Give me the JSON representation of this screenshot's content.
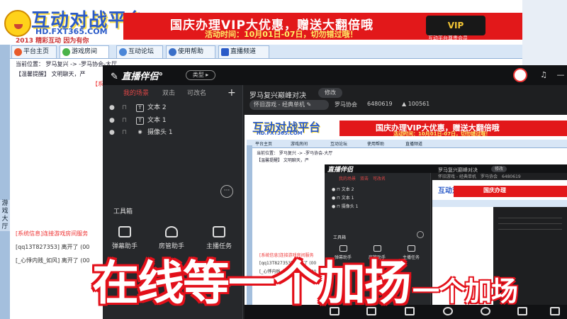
{
  "site": {
    "logo_title": "互动对战平台",
    "logo_url": "HD.FXT365.COM",
    "logo_slogan": "2013 精彩互动 因为有你",
    "banner_title": "国庆办理VIP大优惠，赠送大翻倍哦",
    "banner_sub": "活动时间：10月01日-07日，切勿错过哦！",
    "vip_badge": "VIP",
    "vip_caption": "互动平台尊贵会员",
    "nav_tabs": [
      "平台主页",
      "游戏房间",
      "互动论坛",
      "使用帮助",
      "直播频道"
    ],
    "breadcrumb": "当前位置： 罗马复兴 -> -罗马协会-大厅",
    "notice": "【温馨提醒】 文明聊天，严",
    "system_red": "【系统",
    "game_room_label": "游戏大厅",
    "chat": [
      {
        "text": "[系统信息]连接游戏房间服务",
        "color": "#e33"
      },
      {
        "text": "[qq13T827353]  离开了 (00",
        "color": "#333"
      },
      {
        "text": "[_心悸内贱_如风]  离开了 (00",
        "color": "#333"
      }
    ]
  },
  "app": {
    "logo": "直播伴侣",
    "type_button": "类型",
    "scene_tabs": [
      "我的场景",
      "双击",
      "可改名"
    ],
    "add": "+",
    "sources": [
      {
        "label": "文本 2",
        "type": "T"
      },
      {
        "label": "文本 1",
        "type": "T"
      },
      {
        "label": "摄像头 1",
        "type": "◉"
      }
    ],
    "toolbox": "工具箱",
    "toolbox_more": "···",
    "tools": [
      "弹幕助手",
      "房管助手",
      "主播任务"
    ],
    "stream_title": "罗马复兴巅峰对决",
    "edit": "修改",
    "category": "怀旧游戏 - 经典单机 ✎",
    "room_name": "罗马协会",
    "room_id": "6480619",
    "fans": "▲ 100561"
  },
  "nested": {
    "logo": "互动对战平台",
    "url": "HD.FXT365.COM",
    "banner_title": "国庆办理VIP大优惠，赠送大翻倍哦",
    "banner_sub": "活动时间：10月01日-07日，切勿错过哦！",
    "nav": [
      "平台主页",
      "游戏房间",
      "互动论坛",
      "使用帮助",
      "直播频道"
    ],
    "breadcrumb": "当前位置： 罗马复兴 -> -罗马协会-大厅",
    "notice": "【温馨提醒】 文明聊天，严",
    "system_red": "[系统信息]连接游戏房间服务",
    "chat": "[qq13T827353]  离开了 (00\n[_心悸内贱_如风]  离开了 (00",
    "app_logo": "直播伴侣",
    "app_tabs": "我的场景　双击　可改名",
    "app_rows": [
      "文本 2",
      "文本 1",
      "摄像头 1"
    ],
    "app_toolbox": "工具箱",
    "app_tools": [
      "弹幕助手",
      "房管助手",
      "主播任务"
    ],
    "app_stream_title": "罗马复兴巅峰对决",
    "app_edit": "修改",
    "app_sub": "怀旧游戏 - 经典单机　罗马协会　6480619",
    "n3_logo": "互动对战",
    "n3_banner": "国庆办理"
  },
  "subtitle": {
    "main": "在线等一个加扬",
    "trail": "一个加场"
  }
}
